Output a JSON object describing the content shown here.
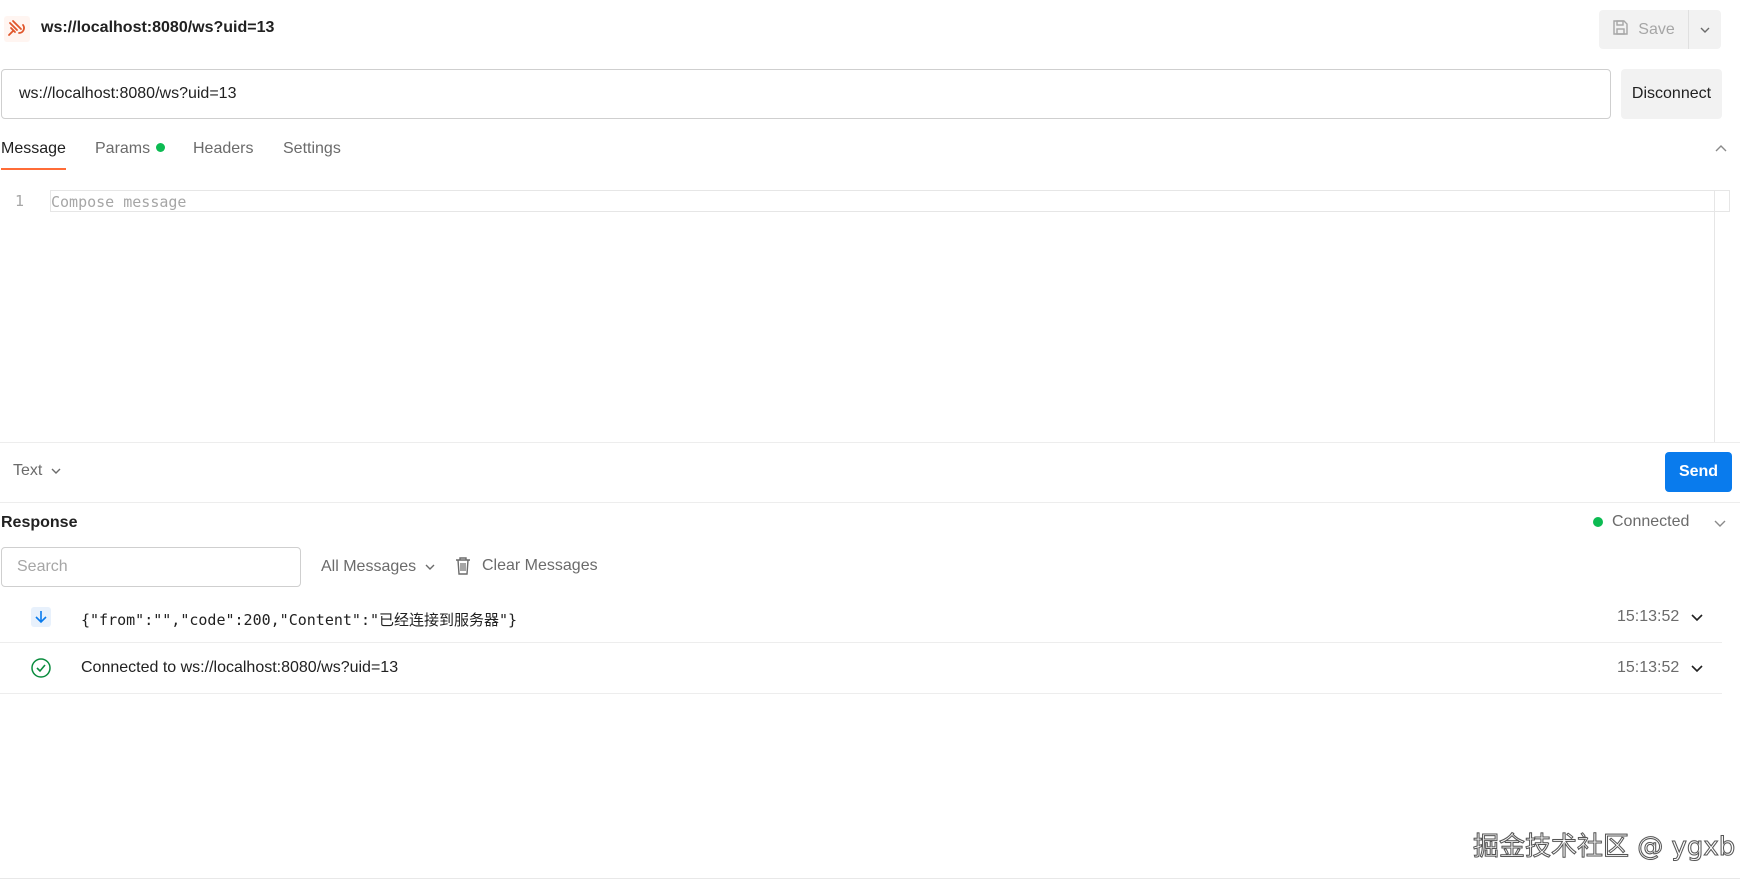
{
  "header": {
    "title": "ws://localhost:8080/ws?uid=13",
    "save_label": "Save"
  },
  "request": {
    "url": "ws://localhost:8080/ws?uid=13",
    "disconnect_label": "Disconnect"
  },
  "tabs": [
    {
      "label": "Message",
      "active": true
    },
    {
      "label": "Params",
      "active": false,
      "indicator": "green-dot"
    },
    {
      "label": "Headers",
      "active": false
    },
    {
      "label": "Settings",
      "active": false
    }
  ],
  "editor": {
    "line_number": "1",
    "placeholder": "Compose message"
  },
  "composer": {
    "type_label": "Text",
    "send_label": "Send"
  },
  "response": {
    "title": "Response",
    "status": "Connected",
    "search_placeholder": "Search",
    "filter_label": "All Messages",
    "clear_label": "Clear Messages",
    "messages": [
      {
        "icon": "arrow-down-icon",
        "text": "{\"from\":\"\",\"code\":200,\"Content\":\"已经连接到服务器\"}",
        "time": "15:13:52"
      },
      {
        "icon": "check-circle-icon",
        "text": "Connected to ws://localhost:8080/ws?uid=13",
        "time": "15:13:52"
      }
    ]
  },
  "watermark": "掘金技术社区 @ ygxb",
  "colors": {
    "accent": "#ff6c37",
    "send_button": "#097bed",
    "status_green": "#0cbb52"
  }
}
